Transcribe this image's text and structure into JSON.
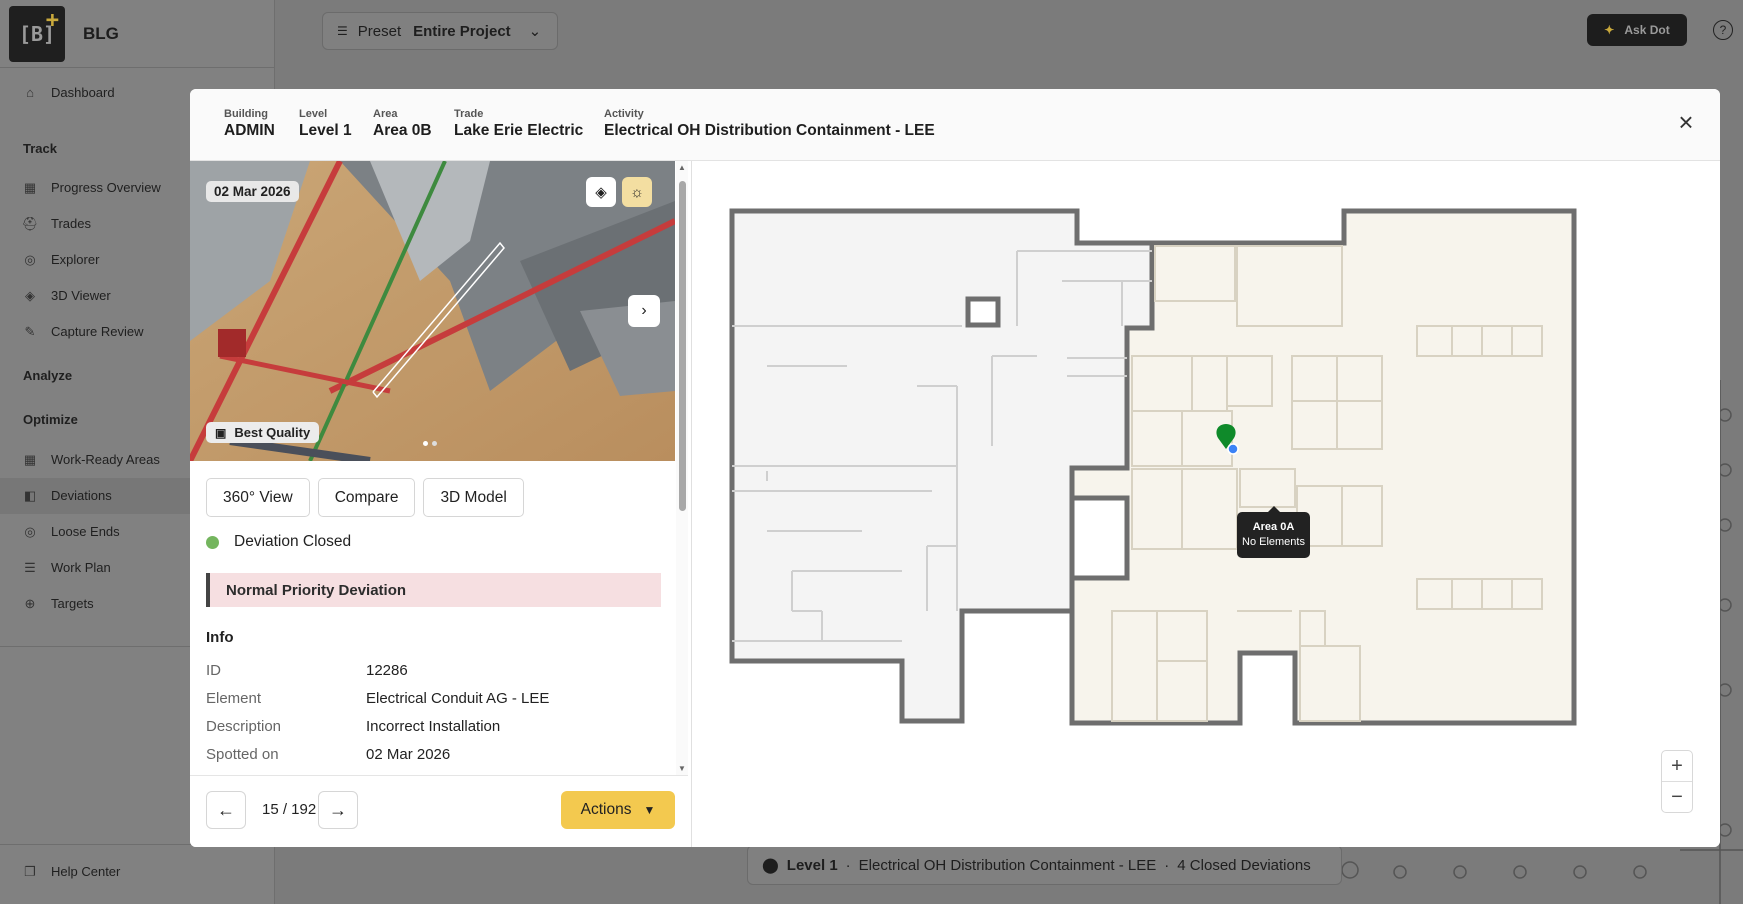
{
  "app": {
    "brand": "BLG",
    "logo_text": "[B]"
  },
  "sidebar": {
    "items": [
      {
        "label": "Dashboard",
        "icon": "home-icon"
      },
      {
        "label": "Progress Overview",
        "icon": "grid-icon"
      },
      {
        "label": "Trades",
        "icon": "hardhat-icon"
      },
      {
        "label": "Explorer",
        "icon": "eye-icon"
      },
      {
        "label": "3D Viewer",
        "icon": "cube-icon"
      },
      {
        "label": "Capture Review",
        "icon": "capture-icon"
      },
      {
        "label": "Work-Ready Areas",
        "icon": "grid-icon"
      },
      {
        "label": "Deviations",
        "icon": "deviation-icon"
      },
      {
        "label": "Loose Ends",
        "icon": "target-icon"
      },
      {
        "label": "Work Plan",
        "icon": "list-icon"
      },
      {
        "label": "Targets",
        "icon": "crosshair-icon"
      },
      {
        "label": "Help Center",
        "icon": "book-icon"
      }
    ],
    "sections": {
      "track": "Track",
      "analyze": "Analyze",
      "optimize": "Optimize"
    }
  },
  "topbar": {
    "preset_label": "Preset",
    "preset_value": "Entire Project",
    "ask_dot": "Ask Dot",
    "help": "?"
  },
  "bottom_card": {
    "level": "Level 1",
    "activity": "Electrical OH Distribution Containment - LEE",
    "count": "4 Closed Deviations",
    "separator": "·"
  },
  "modal": {
    "header": {
      "building_label": "Building",
      "building": "ADMIN",
      "level_label": "Level",
      "level": "Level 1",
      "area_label": "Area",
      "area": "Area 0B",
      "trade_label": "Trade",
      "trade": "Lake Erie Electric",
      "activity_label": "Activity",
      "activity": "Electrical OH Distribution Containment - LEE",
      "close": "×"
    },
    "photo": {
      "date": "02 Mar 2026",
      "quality": "Best Quality",
      "next": "›",
      "slides": 2,
      "active_slide": 1
    },
    "view_buttons": [
      "360° View",
      "Compare",
      "3D Model"
    ],
    "status": "Deviation Closed",
    "priority": "Normal Priority Deviation",
    "info": {
      "title": "Info",
      "rows": [
        {
          "k": "ID",
          "v": "12286"
        },
        {
          "k": "Element",
          "v": "Electrical Conduit AG - LEE"
        },
        {
          "k": "Description",
          "v": "Incorrect Installation"
        },
        {
          "k": "Spotted on",
          "v": "02 Mar 2026"
        }
      ]
    },
    "footer": {
      "prev": "←",
      "next": "→",
      "pager": "15 / 192",
      "actions": "Actions"
    },
    "map": {
      "tooltip_title": "Area 0A",
      "tooltip_sub": "No Elements",
      "zoom_in": "+",
      "zoom_out": "−"
    }
  },
  "colors": {
    "accent": "#f3c94f",
    "status_closed": "#74b55e",
    "priority_bg": "#f6dfe1",
    "pin": "#0f8a2a",
    "location_dot": "#3b82f6"
  }
}
